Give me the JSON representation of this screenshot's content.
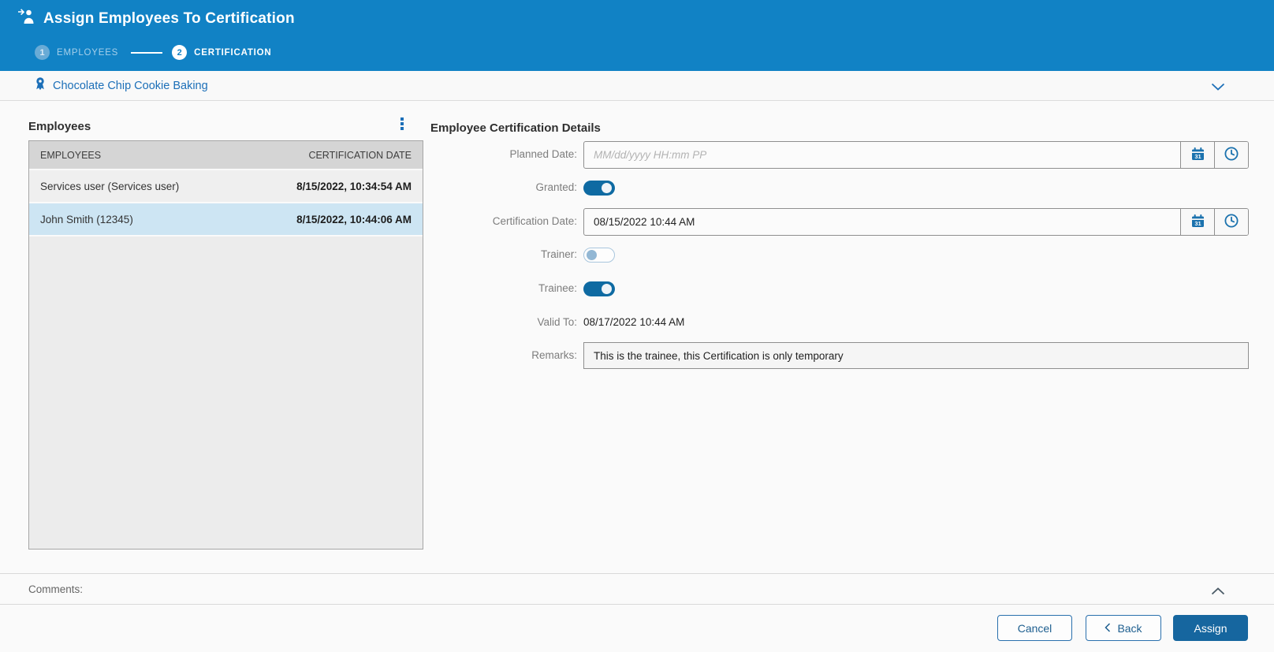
{
  "header": {
    "title": "Assign Employees To Certification",
    "steps": [
      {
        "number": "1",
        "label": "EMPLOYEES",
        "state": "done"
      },
      {
        "number": "2",
        "label": "CERTIFICATION",
        "state": "active"
      }
    ]
  },
  "certification_bar": {
    "name": "Chocolate Chip Cookie Baking"
  },
  "employees_panel": {
    "title": "Employees",
    "table": {
      "columns": [
        "EMPLOYEES",
        "CERTIFICATION DATE"
      ],
      "rows": [
        {
          "employee": "Services user (Services user)",
          "certification_date": "8/15/2022, 10:34:54 AM",
          "selected": false
        },
        {
          "employee": "John Smith (12345)",
          "certification_date": "8/15/2022, 10:44:06 AM",
          "selected": true
        }
      ]
    }
  },
  "details_panel": {
    "title": "Employee Certification Details",
    "fields": {
      "planned_date": {
        "label": "Planned Date:",
        "value": "",
        "placeholder": "MM/dd/yyyy HH:mm PP"
      },
      "granted": {
        "label": "Granted:",
        "value": true
      },
      "certification_date": {
        "label": "Certification Date:",
        "value": "08/15/2022 10:44 AM"
      },
      "trainer": {
        "label": "Trainer:",
        "value": false
      },
      "trainee": {
        "label": "Trainee:",
        "value": true
      },
      "valid_to": {
        "label": "Valid To:",
        "value": "08/17/2022 10:44 AM"
      },
      "remarks": {
        "label": "Remarks:",
        "value": "This is the trainee, this Certification is only temporary"
      }
    }
  },
  "comments": {
    "label": "Comments:"
  },
  "footer": {
    "cancel_label": "Cancel",
    "back_label": "Back",
    "assign_label": "Assign"
  },
  "icons": {
    "calendar_day": "31"
  },
  "colors": {
    "header_blue": "#1182c5",
    "accent_blue": "#1c6fb8",
    "toggle_on": "#0e6aa2",
    "assign_button": "#16669f",
    "selected_row": "#cde5f3",
    "table_header": "#d5d5d5"
  }
}
